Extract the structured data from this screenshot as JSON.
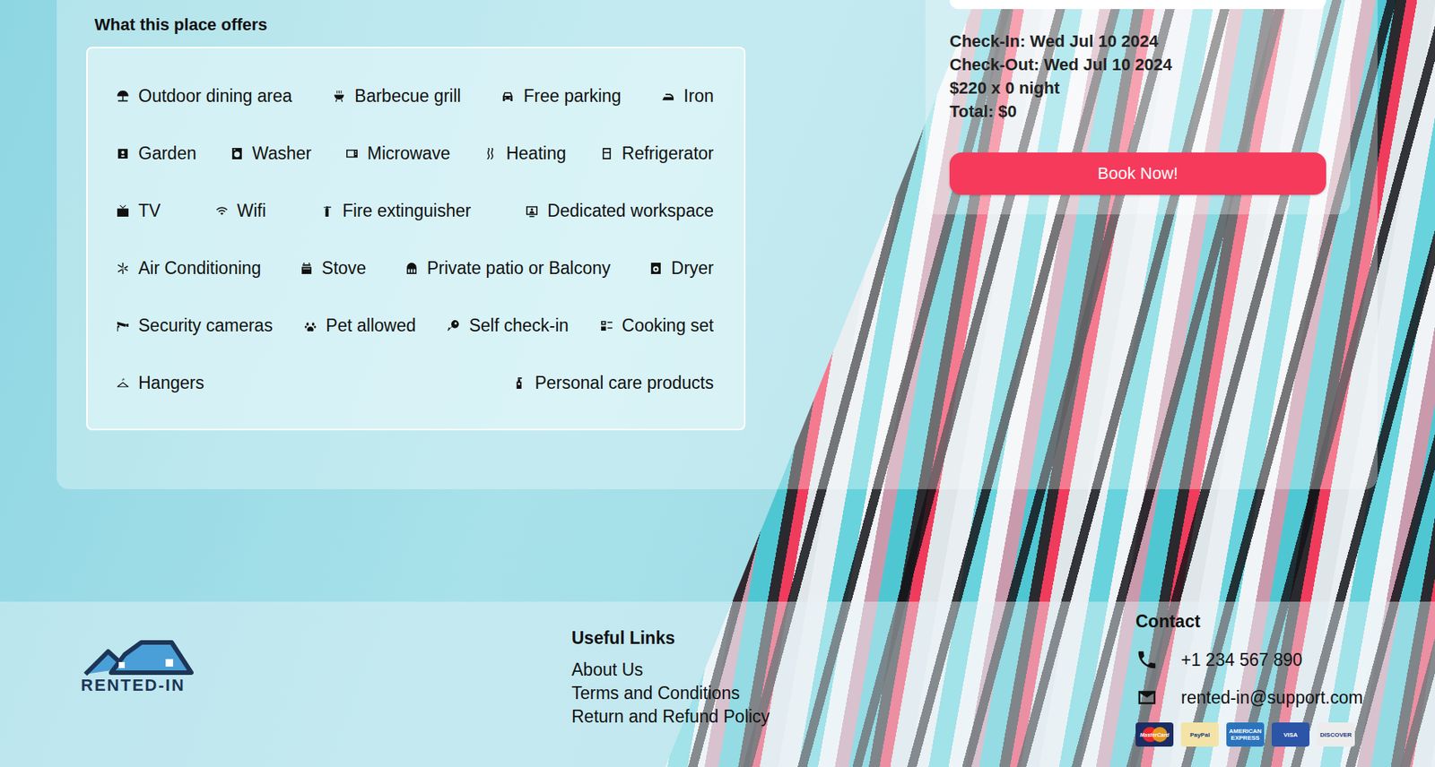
{
  "amenities": {
    "title": "What this place offers",
    "rows": [
      [
        "Outdoor dining area",
        "Barbecue grill",
        "Free parking",
        "Iron"
      ],
      [
        "Garden",
        "Washer",
        "Microwave",
        "Heating",
        "Refrigerator"
      ],
      [
        "TV",
        "Wifi",
        "Fire extinguisher",
        "Dedicated workspace"
      ],
      [
        "Air Conditioning",
        "Stove",
        "Private patio or Balcony",
        "Dryer"
      ],
      [
        "Security cameras",
        "Pet allowed",
        "Self check-in",
        "Cooking set"
      ],
      [
        "Hangers",
        "Personal care products"
      ]
    ]
  },
  "booking": {
    "check_in": "Check-In: Wed Jul 10 2024",
    "check_out": "Check-Out: Wed Jul 10 2024",
    "price_line": "$220 x 0 night",
    "total": "Total: $0",
    "button": "Book Now!"
  },
  "footer": {
    "logo_text": "RENTED-IN",
    "links_title": "Useful Links",
    "links": [
      "About Us",
      "Terms and Conditions",
      "Return and Refund Policy"
    ],
    "contact_title": "Contact",
    "phone": "+1 234 567 890",
    "email": "rented-in@support.com",
    "payment_methods": [
      {
        "label": "MasterCard",
        "kind": "circles",
        "color": "#1b2d63"
      },
      {
        "label": "PayPal",
        "kind": "text",
        "color": "#f3e3a6"
      },
      {
        "label": "AMERICAN EXPRESS",
        "kind": "text",
        "color": "#2b74bd"
      },
      {
        "label": "VISA",
        "kind": "text",
        "color": "#2c55a8"
      },
      {
        "label": "DISCOVER",
        "kind": "text",
        "color": "#ececec"
      }
    ]
  }
}
